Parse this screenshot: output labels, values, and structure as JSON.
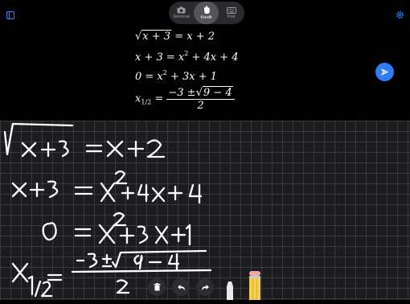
{
  "header": {
    "modes": [
      {
        "label": "Skenovat",
        "icon": "camera-icon",
        "active": false
      },
      {
        "label": "Kreslit",
        "icon": "hand-draw-icon",
        "active": true
      },
      {
        "label": "Psát",
        "icon": "keyboard-icon",
        "active": false
      }
    ],
    "menu_icon": "sidebar-icon",
    "settings_icon": "gear-icon",
    "send_icon": "send-icon"
  },
  "recognized_math": {
    "line1": {
      "radicand": "x + 3",
      "rhs": "= x + 2"
    },
    "line2": {
      "lhs": "x + 3 = x",
      "exp1": "2",
      "rest": " + 4x + 4"
    },
    "line3": {
      "lhs": "0 = x",
      "exp1": "2",
      "rest": " + 3x + 1"
    },
    "line4": {
      "var": "x",
      "sub": "1/2",
      "eq": " = ",
      "num_pre": "−3 ±",
      "num_rad": "9 − 4",
      "den": "2"
    }
  },
  "toolbar": {
    "tools": [
      "trash-icon",
      "undo-icon",
      "redo-icon",
      "pen-icon",
      "pencil-icon"
    ]
  },
  "colors": {
    "accent": "#2f7cf6",
    "background": "#000000",
    "canvas": "#1c1c1e",
    "grid": "#3a3a3c"
  }
}
